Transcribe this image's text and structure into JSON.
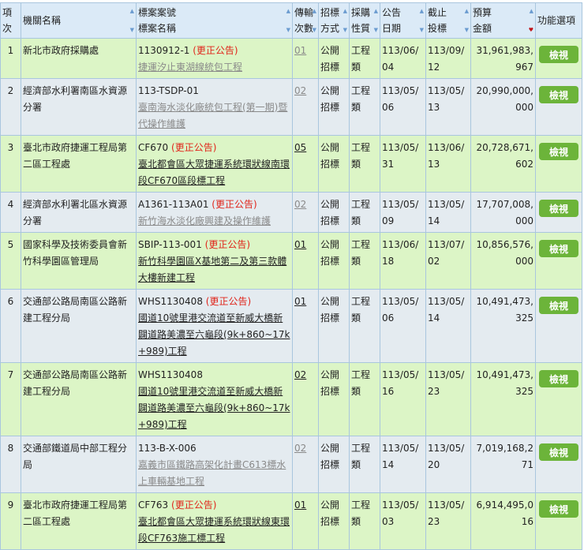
{
  "headers": {
    "index": "項次",
    "agency": "機關名稱",
    "case_no": "標案案號",
    "case_name": "標案名稱",
    "trans1": "傳輸",
    "trans2": "次數",
    "method1": "招標",
    "method2": "方式",
    "nature1": "採購",
    "nature2": "性質",
    "ann1": "公告",
    "ann2": "日期",
    "dead1": "截止",
    "dead2": "投標",
    "budget1": "預算",
    "budget2": "金額",
    "action": "功能選項"
  },
  "correction_label": "(更正公告)",
  "view_label": "檢視",
  "rows": [
    {
      "index": "1",
      "agency": "新北市政府採購處",
      "case_no": "1130912-1",
      "corrected": true,
      "case_name": "捷運汐止東湖線統包工程",
      "visited": true,
      "trans": "01",
      "method": "公開招標",
      "nature": "工程類",
      "ann": "113/06/04",
      "dead": "113/09/12",
      "budget": "31,961,983,967"
    },
    {
      "index": "2",
      "agency": "經濟部水利署南區水資源分署",
      "case_no": "113-TSDP-01",
      "corrected": false,
      "case_name": "臺南海水淡化廠統包工程(第一期)暨代操作維護",
      "visited": true,
      "trans": "02",
      "method": "公開招標",
      "nature": "工程類",
      "ann": "113/05/06",
      "dead": "113/05/13",
      "budget": "20,990,000,000"
    },
    {
      "index": "3",
      "agency": "臺北市政府捷運工程局第二區工程處",
      "case_no": "CF670",
      "corrected": true,
      "case_name": "臺北都會區大眾捷運系統環狀線南環段CF670區段標工程",
      "visited": false,
      "trans": "05",
      "method": "公開招標",
      "nature": "工程類",
      "ann": "113/05/31",
      "dead": "113/06/13",
      "budget": "20,728,671,602"
    },
    {
      "index": "4",
      "agency": "經濟部水利署北區水資源分署",
      "case_no": "A1361-113A01",
      "corrected": true,
      "case_name": "新竹海水淡化廠興建及操作維護",
      "visited": true,
      "trans": "02",
      "method": "公開招標",
      "nature": "工程類",
      "ann": "113/05/09",
      "dead": "113/05/14",
      "budget": "17,707,008,000"
    },
    {
      "index": "5",
      "agency": "國家科學及技術委員會新竹科學園區管理局",
      "case_no": "SBIP-113-001",
      "corrected": true,
      "case_name": "新竹科學園區X基地第二及第三款體大樓新建工程",
      "visited": false,
      "trans": "01",
      "method": "公開招標",
      "nature": "工程類",
      "ann": "113/06/18",
      "dead": "113/07/02",
      "budget": "10,856,576,000"
    },
    {
      "index": "6",
      "agency": "交通部公路局南區公路新建工程分局",
      "case_no": "WHS1130408",
      "corrected": true,
      "case_name": "國道10號里港交流道至新威大橋新闢道路美濃至六龜段(9k+860~17k+989)工程",
      "visited": false,
      "trans": "01",
      "method": "公開招標",
      "nature": "工程類",
      "ann": "113/05/06",
      "dead": "113/05/14",
      "budget": "10,491,473,325"
    },
    {
      "index": "7",
      "agency": "交通部公路局南區公路新建工程分局",
      "case_no": "WHS1130408",
      "corrected": false,
      "case_name": "國道10號里港交流道至新威大橋新闢道路美濃至六龜段(9k+860~17k+989)工程",
      "visited": false,
      "trans": "02",
      "method": "公開招標",
      "nature": "工程類",
      "ann": "113/05/16",
      "dead": "113/05/23",
      "budget": "10,491,473,325"
    },
    {
      "index": "8",
      "agency": "交通部鐵道局中部工程分局",
      "case_no": "113-B-X-006",
      "corrected": false,
      "case_name": "嘉義市區鐵路高架化計畫C613標水上車輛基地工程",
      "visited": true,
      "trans": "02",
      "method": "公開招標",
      "nature": "工程類",
      "ann": "113/05/14",
      "dead": "113/05/20",
      "budget": "7,019,168,271"
    },
    {
      "index": "9",
      "agency": "臺北市政府捷運工程局第二區工程處",
      "case_no": "CF763",
      "corrected": true,
      "case_name": "臺北都會區大眾捷運系統環狀線東環段CF763施工標工程",
      "visited": false,
      "trans": "01",
      "method": "公開招標",
      "nature": "工程類",
      "ann": "113/05/03",
      "dead": "113/05/23",
      "budget": "6,914,495,016"
    }
  ]
}
